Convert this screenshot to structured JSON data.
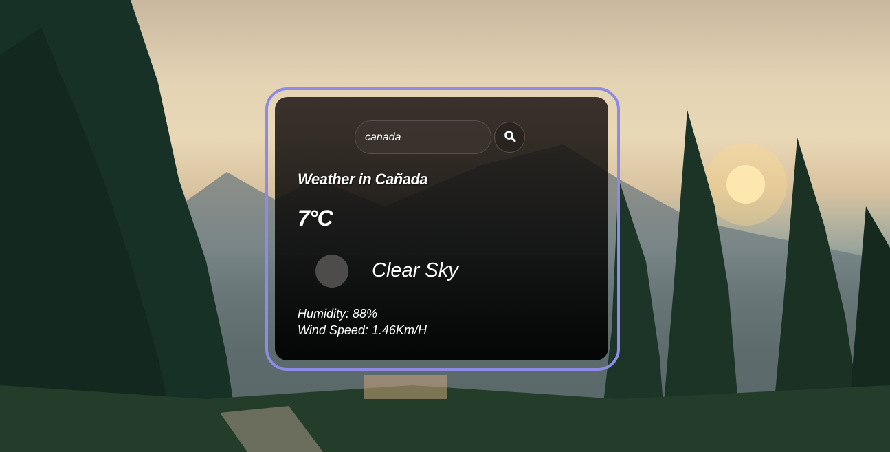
{
  "search": {
    "value": "canada",
    "icon": "search-icon"
  },
  "weather": {
    "title": "Weather in Cañada",
    "temperature": "7°C",
    "description": "Clear Sky",
    "humidity": "Humidity: 88%",
    "wind": "Wind Speed: 1.46Km/H",
    "icon": "weather-icon"
  },
  "colors": {
    "card_outline": "#8e8be6",
    "card_background": "#0f0d0c",
    "text": "#ffffff"
  }
}
